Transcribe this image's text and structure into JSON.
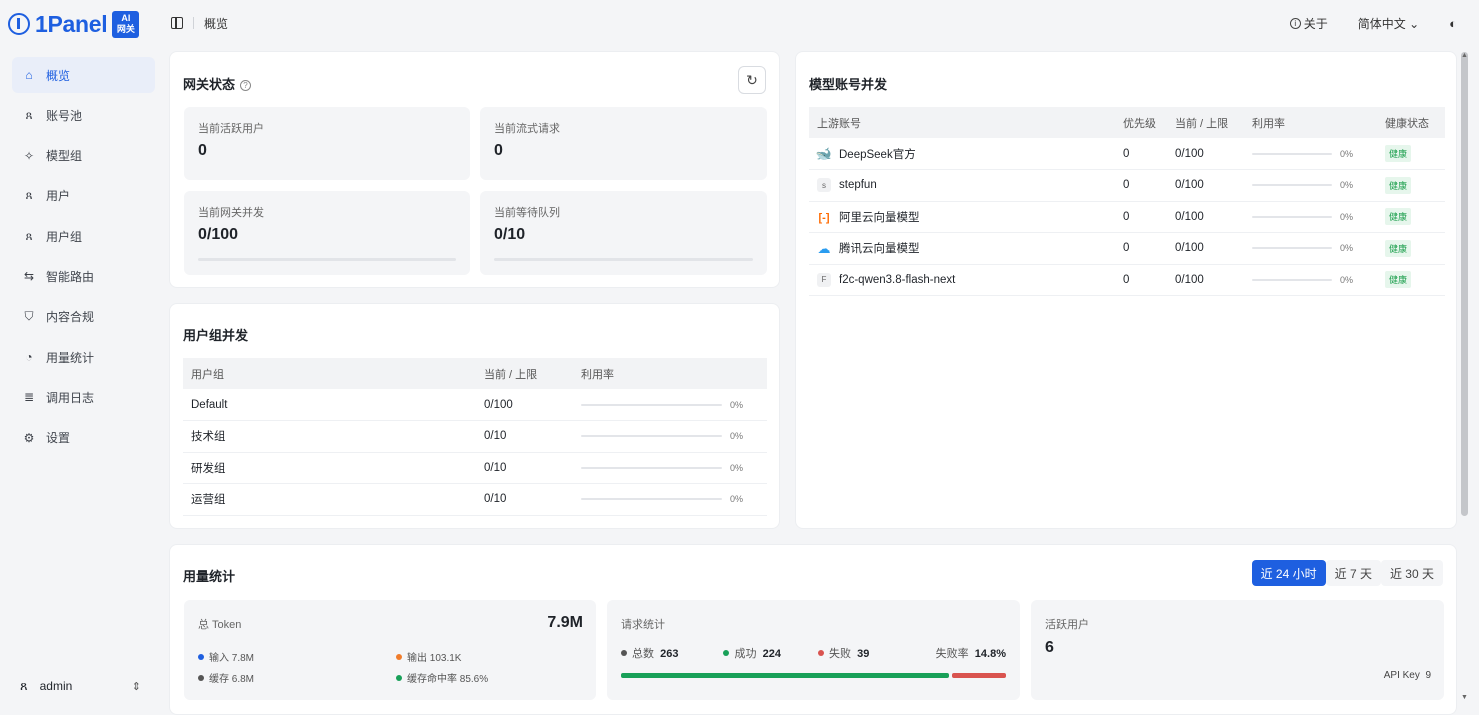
{
  "brand": {
    "name": "1Panel",
    "badge_top": "AI",
    "badge_bottom": "网关"
  },
  "colors": {
    "accent": "#1e5fe0",
    "healthy": "#1fa04f",
    "success": "#18a058",
    "fail": "#d9534f",
    "output": "#f07c2b"
  },
  "sidebar": {
    "items": [
      {
        "label": "概览",
        "icon": "home-icon",
        "glyph": "⌂",
        "active": true
      },
      {
        "label": "账号池",
        "icon": "account-pool-icon",
        "glyph": "ጸ",
        "active": false
      },
      {
        "label": "模型组",
        "icon": "model-group-icon",
        "glyph": "✧",
        "active": false
      },
      {
        "label": "用户",
        "icon": "user-icon",
        "glyph": "ጸ",
        "active": false
      },
      {
        "label": "用户组",
        "icon": "user-group-icon",
        "glyph": "ጸ",
        "active": false
      },
      {
        "label": "智能路由",
        "icon": "route-icon",
        "glyph": "⇆",
        "active": false
      },
      {
        "label": "内容合规",
        "icon": "shield-icon",
        "glyph": "⛉",
        "active": false
      },
      {
        "label": "用量统计",
        "icon": "pie-chart-icon",
        "glyph": "◔",
        "active": false
      },
      {
        "label": "调用日志",
        "icon": "log-icon",
        "glyph": "≣",
        "active": false
      },
      {
        "label": "设置",
        "icon": "settings-icon",
        "glyph": "⚙",
        "active": false
      }
    ],
    "user": {
      "name": "admin",
      "icon": "user-icon",
      "caret": "⇕"
    }
  },
  "header": {
    "breadcrumb": "概览",
    "about": "关于",
    "language": "简体中文 ⌄",
    "theme_glyph": "◐"
  },
  "gateway": {
    "title": "网关状态",
    "help_glyph": "?",
    "refresh_glyph": "↻",
    "stats": [
      {
        "label": "当前活跃用户",
        "value": "0"
      },
      {
        "label": "当前流式请求",
        "value": "0"
      },
      {
        "label": "当前网关并发",
        "value": "0/100",
        "fill": 0
      },
      {
        "label": "当前等待队列",
        "value": "0/10",
        "fill": 0
      }
    ]
  },
  "group_concurrency": {
    "title": "用户组并发",
    "columns": [
      "用户组",
      "当前 / 上限",
      "利用率"
    ],
    "rows": [
      {
        "name": "Default",
        "current": "0/100",
        "util": "0%",
        "fill": 0
      },
      {
        "name": "技术组",
        "current": "0/10",
        "util": "0%",
        "fill": 0
      },
      {
        "name": "研发组",
        "current": "0/10",
        "util": "0%",
        "fill": 0
      },
      {
        "name": "运营组",
        "current": "0/10",
        "util": "0%",
        "fill": 0
      }
    ]
  },
  "model_accounts": {
    "title": "模型账号并发",
    "columns": [
      "上游账号",
      "优先级",
      "当前 / 上限",
      "利用率",
      "健康状态"
    ],
    "rows": [
      {
        "name": "DeepSeek官方",
        "icon": "deepseek-icon",
        "icon_text": "🐋",
        "icon_class": "ds",
        "priority": "0",
        "current": "0/100",
        "util": "0%",
        "fill": 0,
        "health": "健康"
      },
      {
        "name": "stepfun",
        "icon": "stepfun-icon",
        "icon_text": "s",
        "icon_class": "letter",
        "priority": "0",
        "current": "0/100",
        "util": "0%",
        "fill": 0,
        "health": "健康"
      },
      {
        "name": "阿里云向量模型",
        "icon": "aliyun-icon",
        "icon_text": "[-]",
        "icon_class": "ali",
        "priority": "0",
        "current": "0/100",
        "util": "0%",
        "fill": 0,
        "health": "健康"
      },
      {
        "name": "腾讯云向量模型",
        "icon": "tencent-cloud-icon",
        "icon_text": "☁",
        "icon_class": "tx",
        "priority": "0",
        "current": "0/100",
        "util": "0%",
        "fill": 0,
        "health": "健康"
      },
      {
        "name": "f2c-qwen3.8-flash-next",
        "icon": "letter-f-icon",
        "icon_text": "F",
        "icon_class": "letter",
        "priority": "0",
        "current": "0/100",
        "util": "0%",
        "fill": 0,
        "health": "健康"
      }
    ]
  },
  "usage": {
    "title": "用量统计",
    "ranges": [
      {
        "label": "近 24 小时",
        "active": true
      },
      {
        "label": "近 7 天",
        "active": false
      },
      {
        "label": "近 30 天",
        "active": false
      }
    ],
    "token": {
      "label": "总 Token",
      "total": "7.9M",
      "input": "输入 7.8M",
      "output": "输出 103.1K",
      "cache": "缓存 6.8M",
      "cache_hit": "缓存命中率 85.6%"
    },
    "requests": {
      "label": "请求统计",
      "total_label": "总数",
      "total": "263",
      "success_label": "成功",
      "success": "224",
      "fail_label": "失败",
      "fail": "39",
      "fail_rate_label": "失败率",
      "fail_rate": "14.8%",
      "success_fraction": 0.852
    },
    "active_users": {
      "label": "活跃用户",
      "value": "6",
      "api_key_label": "API Key",
      "api_key_count": "9"
    }
  }
}
